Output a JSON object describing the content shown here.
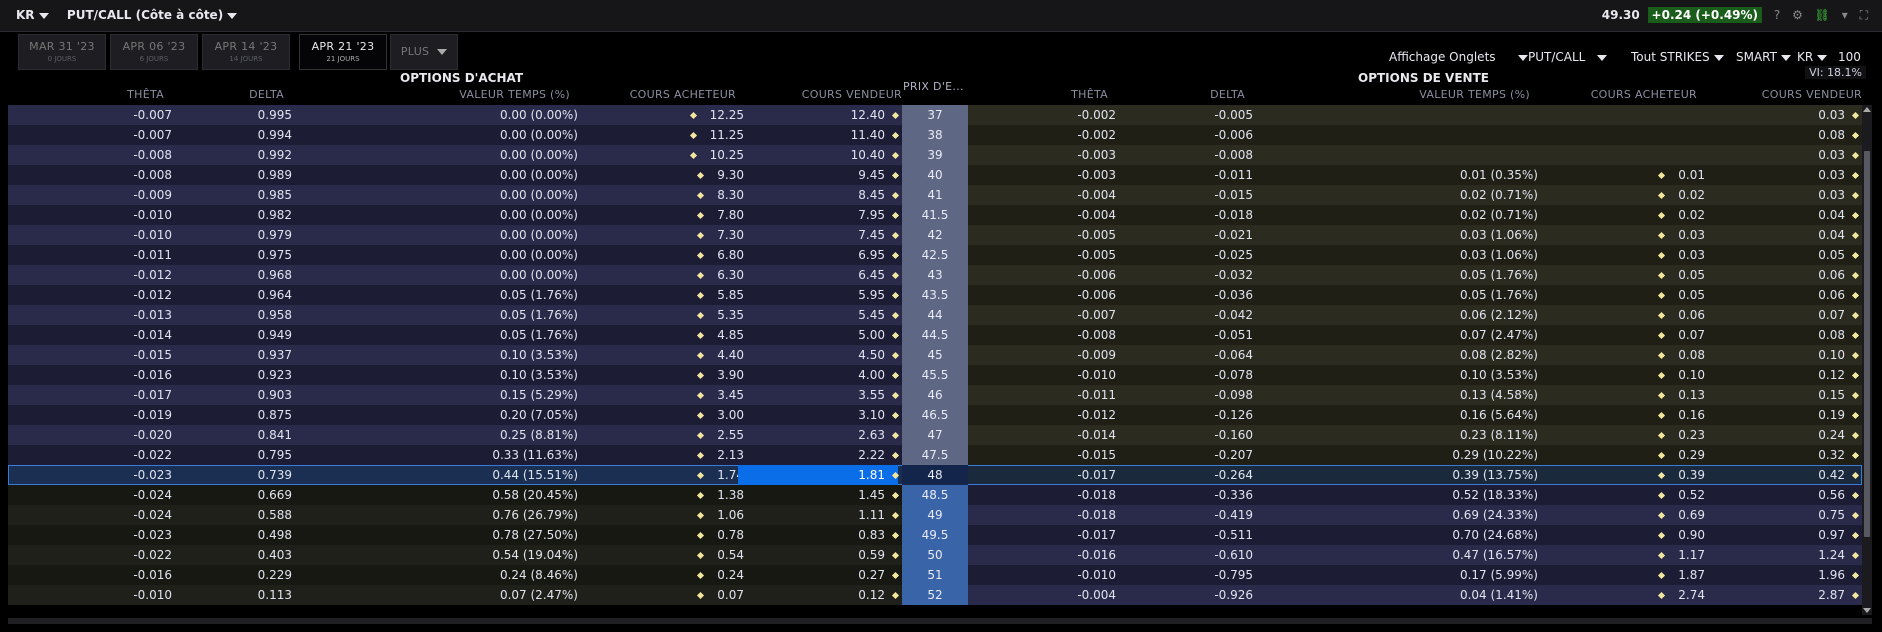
{
  "header": {
    "symbol": "KR",
    "view_label": "PUT/CALL (Côte à côte)",
    "price": "49.30",
    "change": "+0.24 (+0.49%)"
  },
  "tabs": [
    {
      "label": "MAR 31 '23",
      "sub": "0 JOURS"
    },
    {
      "label": "APR 06 '23",
      "sub": "6 JOURS"
    },
    {
      "label": "APR 14 '23",
      "sub": "14 JOURS"
    },
    {
      "label": "APR 21 '23",
      "sub": "21 JOURS",
      "active": true
    },
    {
      "label": "PLUS"
    }
  ],
  "toolbar": {
    "display": "Affichage Onglets",
    "putcall": "PUT/CALL",
    "strikes": "Tout STRIKES",
    "exchange": "SMART",
    "symbol": "KR",
    "qty": "100",
    "vi": "VI: 18.1%"
  },
  "sections": {
    "calls": "OPTIONS D'ACHAT",
    "puts": "OPTIONS DE VENTE"
  },
  "columns": {
    "theta": "THÊTA",
    "delta": "DELTA",
    "time_value": "VALEUR TEMPS (%)",
    "bid": "COURS ACHETEUR",
    "ask": "COURS VENDEUR",
    "strike": "PRIX D'E..."
  },
  "rows": [
    {
      "strike": "37",
      "c_theta": "-0.007",
      "c_delta": "0.995",
      "c_tv": "0.00 (0.00%)",
      "c_bid": "12.25",
      "c_ask": "12.40",
      "p_theta": "-0.002",
      "p_delta": "-0.005",
      "p_tv": "",
      "p_bid": "",
      "p_ask": "0.03"
    },
    {
      "strike": "38",
      "c_theta": "-0.007",
      "c_delta": "0.994",
      "c_tv": "0.00 (0.00%)",
      "c_bid": "11.25",
      "c_ask": "11.40",
      "p_theta": "-0.002",
      "p_delta": "-0.006",
      "p_tv": "",
      "p_bid": "",
      "p_ask": "0.08"
    },
    {
      "strike": "39",
      "c_theta": "-0.008",
      "c_delta": "0.992",
      "c_tv": "0.00 (0.00%)",
      "c_bid": "10.25",
      "c_ask": "10.40",
      "p_theta": "-0.003",
      "p_delta": "-0.008",
      "p_tv": "",
      "p_bid": "",
      "p_ask": "0.03"
    },
    {
      "strike": "40",
      "c_theta": "-0.008",
      "c_delta": "0.989",
      "c_tv": "0.00 (0.00%)",
      "c_bid": "9.30",
      "c_ask": "9.45",
      "p_theta": "-0.003",
      "p_delta": "-0.011",
      "p_tv": "0.01 (0.35%)",
      "p_bid": "0.01",
      "p_ask": "0.03"
    },
    {
      "strike": "41",
      "c_theta": "-0.009",
      "c_delta": "0.985",
      "c_tv": "0.00 (0.00%)",
      "c_bid": "8.30",
      "c_ask": "8.45",
      "p_theta": "-0.004",
      "p_delta": "-0.015",
      "p_tv": "0.02 (0.71%)",
      "p_bid": "0.02",
      "p_ask": "0.03"
    },
    {
      "strike": "41.5",
      "c_theta": "-0.010",
      "c_delta": "0.982",
      "c_tv": "0.00 (0.00%)",
      "c_bid": "7.80",
      "c_ask": "7.95",
      "p_theta": "-0.004",
      "p_delta": "-0.018",
      "p_tv": "0.02 (0.71%)",
      "p_bid": "0.02",
      "p_ask": "0.04"
    },
    {
      "strike": "42",
      "c_theta": "-0.010",
      "c_delta": "0.979",
      "c_tv": "0.00 (0.00%)",
      "c_bid": "7.30",
      "c_ask": "7.45",
      "p_theta": "-0.005",
      "p_delta": "-0.021",
      "p_tv": "0.03 (1.06%)",
      "p_bid": "0.03",
      "p_ask": "0.04"
    },
    {
      "strike": "42.5",
      "c_theta": "-0.011",
      "c_delta": "0.975",
      "c_tv": "0.00 (0.00%)",
      "c_bid": "6.80",
      "c_ask": "6.95",
      "p_theta": "-0.005",
      "p_delta": "-0.025",
      "p_tv": "0.03 (1.06%)",
      "p_bid": "0.03",
      "p_ask": "0.05"
    },
    {
      "strike": "43",
      "c_theta": "-0.012",
      "c_delta": "0.968",
      "c_tv": "0.00 (0.00%)",
      "c_bid": "6.30",
      "c_ask": "6.45",
      "p_theta": "-0.006",
      "p_delta": "-0.032",
      "p_tv": "0.05 (1.76%)",
      "p_bid": "0.05",
      "p_ask": "0.06"
    },
    {
      "strike": "43.5",
      "c_theta": "-0.012",
      "c_delta": "0.964",
      "c_tv": "0.05 (1.76%)",
      "c_bid": "5.85",
      "c_ask": "5.95",
      "p_theta": "-0.006",
      "p_delta": "-0.036",
      "p_tv": "0.05 (1.76%)",
      "p_bid": "0.05",
      "p_ask": "0.06"
    },
    {
      "strike": "44",
      "c_theta": "-0.013",
      "c_delta": "0.958",
      "c_tv": "0.05 (1.76%)",
      "c_bid": "5.35",
      "c_ask": "5.45",
      "p_theta": "-0.007",
      "p_delta": "-0.042",
      "p_tv": "0.06 (2.12%)",
      "p_bid": "0.06",
      "p_ask": "0.07"
    },
    {
      "strike": "44.5",
      "c_theta": "-0.014",
      "c_delta": "0.949",
      "c_tv": "0.05 (1.76%)",
      "c_bid": "4.85",
      "c_ask": "5.00",
      "p_theta": "-0.008",
      "p_delta": "-0.051",
      "p_tv": "0.07 (2.47%)",
      "p_bid": "0.07",
      "p_ask": "0.08"
    },
    {
      "strike": "45",
      "c_theta": "-0.015",
      "c_delta": "0.937",
      "c_tv": "0.10 (3.53%)",
      "c_bid": "4.40",
      "c_ask": "4.50",
      "p_theta": "-0.009",
      "p_delta": "-0.064",
      "p_tv": "0.08 (2.82%)",
      "p_bid": "0.08",
      "p_ask": "0.10"
    },
    {
      "strike": "45.5",
      "c_theta": "-0.016",
      "c_delta": "0.923",
      "c_tv": "0.10 (3.53%)",
      "c_bid": "3.90",
      "c_ask": "4.00",
      "p_theta": "-0.010",
      "p_delta": "-0.078",
      "p_tv": "0.10 (3.53%)",
      "p_bid": "0.10",
      "p_ask": "0.12"
    },
    {
      "strike": "46",
      "c_theta": "-0.017",
      "c_delta": "0.903",
      "c_tv": "0.15 (5.29%)",
      "c_bid": "3.45",
      "c_ask": "3.55",
      "p_theta": "-0.011",
      "p_delta": "-0.098",
      "p_tv": "0.13 (4.58%)",
      "p_bid": "0.13",
      "p_ask": "0.15"
    },
    {
      "strike": "46.5",
      "c_theta": "-0.019",
      "c_delta": "0.875",
      "c_tv": "0.20 (7.05%)",
      "c_bid": "3.00",
      "c_ask": "3.10",
      "p_theta": "-0.012",
      "p_delta": "-0.126",
      "p_tv": "0.16 (5.64%)",
      "p_bid": "0.16",
      "p_ask": "0.19"
    },
    {
      "strike": "47",
      "c_theta": "-0.020",
      "c_delta": "0.841",
      "c_tv": "0.25 (8.81%)",
      "c_bid": "2.55",
      "c_ask": "2.63",
      "p_theta": "-0.014",
      "p_delta": "-0.160",
      "p_tv": "0.23 (8.11%)",
      "p_bid": "0.23",
      "p_ask": "0.24"
    },
    {
      "strike": "47.5",
      "c_theta": "-0.022",
      "c_delta": "0.795",
      "c_tv": "0.33 (11.63%)",
      "c_bid": "2.13",
      "c_ask": "2.22",
      "p_theta": "-0.015",
      "p_delta": "-0.207",
      "p_tv": "0.29 (10.22%)",
      "p_bid": "0.29",
      "p_ask": "0.32"
    },
    {
      "strike": "48",
      "c_theta": "-0.023",
      "c_delta": "0.739",
      "c_tv": "0.44 (15.51%)",
      "c_bid": "1.74",
      "c_ask": "1.81",
      "p_theta": "-0.017",
      "p_delta": "-0.264",
      "p_tv": "0.39 (13.75%)",
      "p_bid": "0.39",
      "p_ask": "0.42",
      "selected": true
    },
    {
      "strike": "48.5",
      "c_theta": "-0.024",
      "c_delta": "0.669",
      "c_tv": "0.58 (20.45%)",
      "c_bid": "1.38",
      "c_ask": "1.45",
      "p_theta": "-0.018",
      "p_delta": "-0.336",
      "p_tv": "0.52 (18.33%)",
      "p_bid": "0.52",
      "p_ask": "0.56"
    },
    {
      "strike": "49",
      "c_theta": "-0.024",
      "c_delta": "0.588",
      "c_tv": "0.76 (26.79%)",
      "c_bid": "1.06",
      "c_ask": "1.11",
      "p_theta": "-0.018",
      "p_delta": "-0.419",
      "p_tv": "0.69 (24.33%)",
      "p_bid": "0.69",
      "p_ask": "0.75"
    },
    {
      "strike": "49.5",
      "c_theta": "-0.023",
      "c_delta": "0.498",
      "c_tv": "0.78 (27.50%)",
      "c_bid": "0.78",
      "c_ask": "0.83",
      "p_theta": "-0.017",
      "p_delta": "-0.511",
      "p_tv": "0.70 (24.68%)",
      "p_bid": "0.90",
      "p_ask": "0.97"
    },
    {
      "strike": "50",
      "c_theta": "-0.022",
      "c_delta": "0.403",
      "c_tv": "0.54 (19.04%)",
      "c_bid": "0.54",
      "c_ask": "0.59",
      "p_theta": "-0.016",
      "p_delta": "-0.610",
      "p_tv": "0.47 (16.57%)",
      "p_bid": "1.17",
      "p_ask": "1.24"
    },
    {
      "strike": "51",
      "c_theta": "-0.016",
      "c_delta": "0.229",
      "c_tv": "0.24 (8.46%)",
      "c_bid": "0.24",
      "c_ask": "0.27",
      "p_theta": "-0.010",
      "p_delta": "-0.795",
      "p_tv": "0.17 (5.99%)",
      "p_bid": "1.87",
      "p_ask": "1.96"
    },
    {
      "strike": "52",
      "c_theta": "-0.010",
      "c_delta": "0.113",
      "c_tv": "0.07 (2.47%)",
      "c_bid": "0.07",
      "c_ask": "0.12",
      "p_theta": "-0.004",
      "p_delta": "-0.926",
      "p_tv": "0.04 (1.41%)",
      "p_bid": "2.74",
      "p_ask": "2.87"
    }
  ]
}
